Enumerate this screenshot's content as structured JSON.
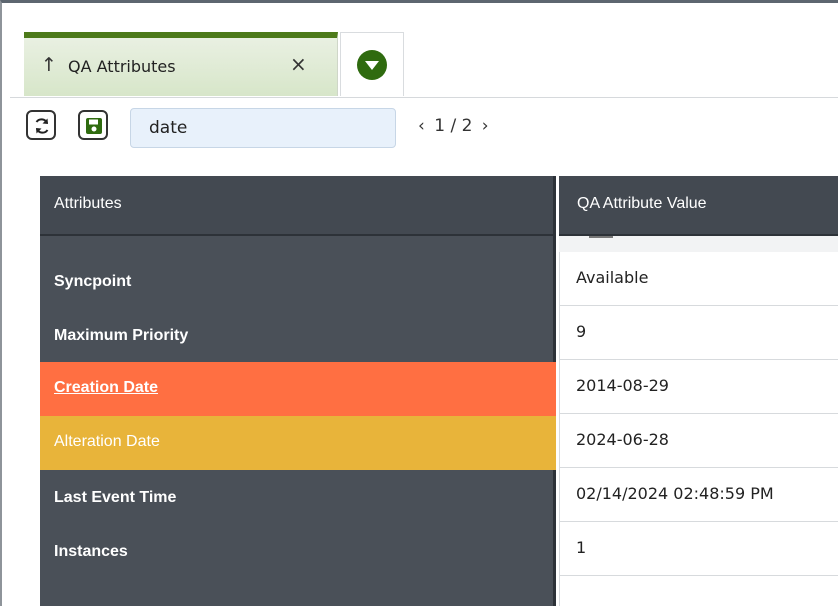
{
  "tab": {
    "arrow": "↑",
    "label": "QA Attributes",
    "close": "×",
    "menu_icon": "chevron-down-circle-icon"
  },
  "toolbar": {
    "refresh_icon": "refresh-icon",
    "save_icon": "save-icon",
    "search_value": "date",
    "pager_prev": "‹",
    "pager_text": "1 / 2",
    "pager_next": "›"
  },
  "table": {
    "headers": {
      "attributes": "Attributes",
      "value": "QA Attribute Value"
    },
    "rows": [
      {
        "attribute": "Syncpoint",
        "value": "Available",
        "highlight": ""
      },
      {
        "attribute": "Maximum Priority",
        "value": "9",
        "highlight": ""
      },
      {
        "attribute": "Creation Date",
        "value": "2014-08-29",
        "highlight": "#ff6f42"
      },
      {
        "attribute": "Alteration Date",
        "value": "2024-06-28",
        "highlight": "#e8b43a"
      },
      {
        "attribute": "Last Event Time",
        "value": "02/14/2024 02:48:59 PM",
        "highlight": ""
      },
      {
        "attribute": "Instances",
        "value": "1",
        "highlight": ""
      }
    ]
  },
  "colors": {
    "tab_accent": "#4d7a1a",
    "header_bg": "#434951",
    "attribute_col_bg": "#4a5058",
    "search_bg": "#e8f1fb"
  }
}
